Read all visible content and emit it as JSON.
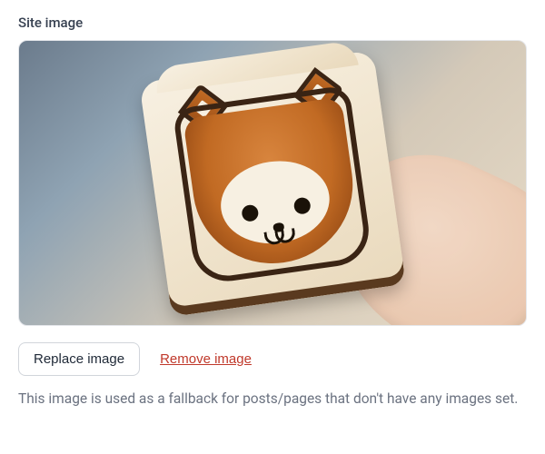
{
  "section": {
    "label": "Site image",
    "image_alt": "toast-bread-with-cat-face-art",
    "replace_label": "Replace image",
    "remove_label": "Remove image",
    "help_text": "This image is used as a fallback for posts/pages that don't have any images set."
  }
}
